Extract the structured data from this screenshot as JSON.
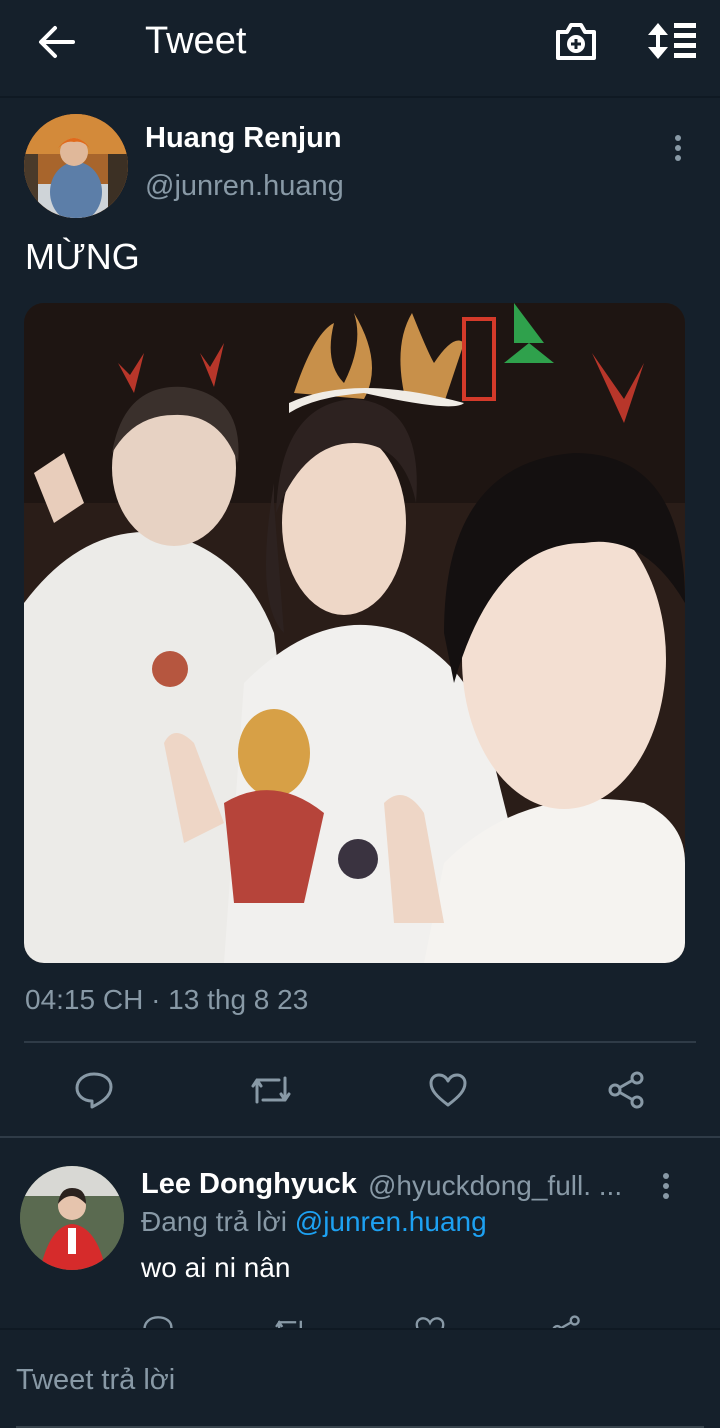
{
  "colors": {
    "background": "#15202b",
    "secondary_text": "#8899a6",
    "accent": "#1da1f2",
    "divider": "#2f3b47"
  },
  "header": {
    "back_icon": "arrow-left-icon",
    "title": "Tweet",
    "camera_icon": "camera-plus-icon",
    "sort_icon": "sort-list-icon"
  },
  "tweet": {
    "author_name": "Huang Renjun",
    "author_handle": "@junren.huang",
    "text": "MỪNG",
    "timestamp": "04:15 CH · 13 thg 8 23",
    "actions": [
      "reply-icon",
      "retweet-icon",
      "like-icon",
      "share-icon"
    ]
  },
  "reply": {
    "author_name": "Lee Donghyuck",
    "author_handle": "@hyuckdong_full. ...",
    "replying_prefix": "Đang trả lời",
    "replying_mention": "@junren.huang",
    "text": "wo ai ni nân"
  },
  "composer": {
    "placeholder": "Tweet trả lời",
    "value": ""
  }
}
